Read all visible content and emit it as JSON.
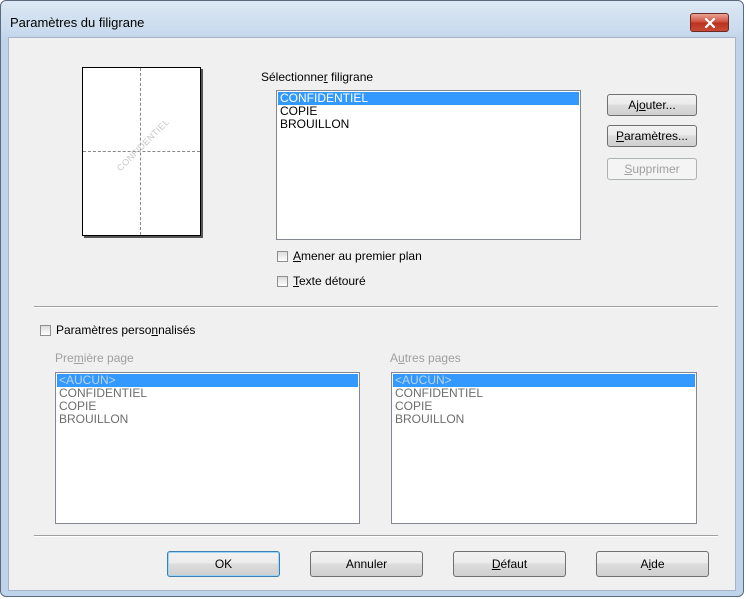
{
  "window": {
    "title": "Paramètres du filigrane"
  },
  "preview": {
    "watermark_text": "CONFIDENTIEL"
  },
  "select_watermark": {
    "label": "Sélectionner filigrane",
    "items": [
      "CONFIDENTIEL",
      "COPIE",
      "BROUILLON"
    ],
    "selected": "CONFIDENTIEL"
  },
  "buttons": {
    "add": "Ajouter...",
    "settings": "Paramètres...",
    "delete": "Supprimer",
    "ok": "OK",
    "cancel": "Annuler",
    "default": "Défaut",
    "help": "Aide"
  },
  "options": {
    "bring_to_front": "Amener au premier plan",
    "outline_text": "Texte détouré",
    "custom_settings": "Paramètres personnalisés"
  },
  "first_page": {
    "label": "Première page",
    "items": [
      "<AUCUN>",
      "CONFIDENTIEL",
      "COPIE",
      "BROUILLON"
    ],
    "selected": "<AUCUN>"
  },
  "other_pages": {
    "label": "Autres pages",
    "items": [
      "<AUCUN>",
      "CONFIDENTIEL",
      "COPIE",
      "BROUILLON"
    ],
    "selected": "<AUCUN>"
  },
  "colors": {
    "selection": "#3399ff",
    "close_button": "#c94a35"
  }
}
